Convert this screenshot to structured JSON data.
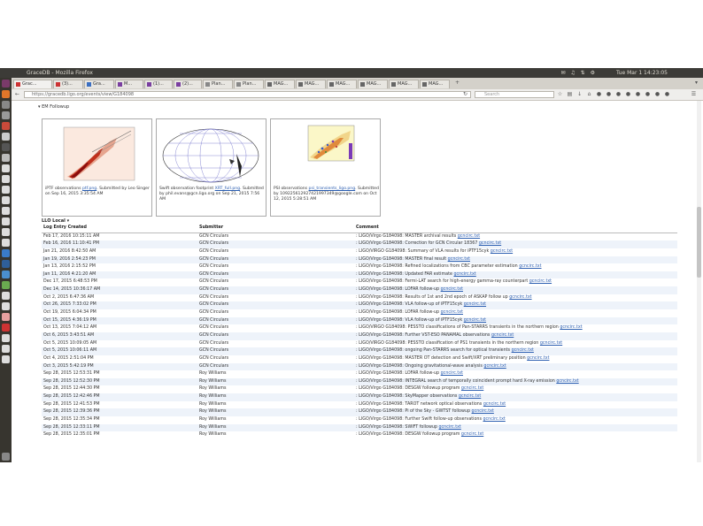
{
  "system": {
    "window_title": "GraceDB - Mozilla Firefox",
    "clock": "Tue Mar 1 14:23:05"
  },
  "browser": {
    "tabs": [
      {
        "label": "Grac..."
      },
      {
        "label": "(3)..."
      },
      {
        "label": "Gra..."
      },
      {
        "label": "M..."
      },
      {
        "label": "(1)..."
      },
      {
        "label": "(2)..."
      },
      {
        "label": "Plan..."
      },
      {
        "label": "Plan..."
      },
      {
        "label": "MAG..."
      },
      {
        "label": "MAG..."
      },
      {
        "label": "MAG..."
      },
      {
        "label": "MAG..."
      },
      {
        "label": "MAG..."
      },
      {
        "label": "MAG..."
      }
    ],
    "url": "https://gracedb.ligo.org/events/view/G184098",
    "search_placeholder": "Search"
  },
  "panel": {
    "title": "EM Followup"
  },
  "thumbnails": [
    {
      "caption_before": "iPTF observations ",
      "link": "ptf.png",
      "caption_after": ". Submitted by Leo Singer on Sep 16, 2015 3:35:54 AM"
    },
    {
      "caption_before": "Swift observation footprint ",
      "link": "XRT_full.png",
      "caption_after": ". Submitted by phil.evans@gcn.ligo.org on Sep 21, 2015 7:56 AM"
    },
    {
      "caption_before": "PSI observations ",
      "link": "psi_transients_ligo.png",
      "caption_after": ". Submitted by 109225612927421997349@google.com on Oct 12, 2015 5:28:51 AM"
    }
  ],
  "log": {
    "section_label": "LLO Local",
    "headers": {
      "col1": "Log Entry Created",
      "col2": "Submitter",
      "col3": "Comment"
    },
    "rows": [
      {
        "created": "Feb 17, 2016 10:15:11 AM",
        "submitter": "GCN Circulars",
        "comment": ": LIGO/Virgo G184098: MASTER archival results ",
        "link": "gcncirc.txt"
      },
      {
        "created": "Feb 16, 2016 11:10:41 PM",
        "submitter": "GCN Circulars",
        "comment": ": LIGO/Virgo G184098: Correction for GCN Circular 18367 ",
        "link": "gcncirc.txt"
      },
      {
        "created": "Jan 21, 2016 8:42:50 AM",
        "submitter": "GCN Circulars",
        "comment": ": LIGO/VIRGO G184098: Summary of VLA results for iPTF15cyk ",
        "link": "gcncirc.txt"
      },
      {
        "created": "Jan 19, 2016 2:54:23 PM",
        "submitter": "GCN Circulars",
        "comment": ": LIGO/Virgo G184098: MASTER final result ",
        "link": "gcncirc.txt"
      },
      {
        "created": "Jan 13, 2016 2:15:52 PM",
        "submitter": "GCN Circulars",
        "comment": ": LIGO/Virgo G184098: Refined localizations from CBC parameter estimation ",
        "link": "gcncirc.txt"
      },
      {
        "created": "Jan 11, 2016 4:21:20 AM",
        "submitter": "GCN Circulars",
        "comment": ": LIGO/Virgo G184098: Updated FAR estimate ",
        "link": "gcncirc.txt"
      },
      {
        "created": "Dec 17, 2015 6:48:53 PM",
        "submitter": "GCN Circulars",
        "comment": ": LIGO/Virgo G184098: Fermi-LAT search for high-energy gamma-ray counterpart ",
        "link": "gcncirc.txt"
      },
      {
        "created": "Dec 14, 2015 10:36:17 AM",
        "submitter": "GCN Circulars",
        "comment": ": LIGO/Virgo G184098: LOFAR follow-up ",
        "link": "gcncirc.txt"
      },
      {
        "created": "Oct 2, 2015 6:47:36 AM",
        "submitter": "GCN Circulars",
        "comment": ": LIGO/Virgo G184098: Results of 1st and 2nd epoch of ASKAP follow up ",
        "link": "gcncirc.txt"
      },
      {
        "created": "Oct 26, 2015 7:33:02 PM",
        "submitter": "GCN Circulars",
        "comment": ": LIGO/Virgo G184098: VLA follow-up of iPTF15cyk ",
        "link": "gcncirc.txt"
      },
      {
        "created": "Oct 19, 2015 6:04:34 PM",
        "submitter": "GCN Circulars",
        "comment": ": LIGO/Virgo G184098: LOFAR follow-up ",
        "link": "gcncirc.txt"
      },
      {
        "created": "Oct 15, 2015 4:36:19 PM",
        "submitter": "GCN Circulars",
        "comment": ": LIGO/Virgo G184098: VLA follow-up of iPTF15cyk ",
        "link": "gcncirc.txt"
      },
      {
        "created": "Oct 13, 2015 7:04:12 AM",
        "submitter": "GCN Circulars",
        "comment": ": LIGO/VIRGO G184098: PESSTO classifications of Pan-STARRS transients in the northern region ",
        "link": "gcncirc.txt"
      },
      {
        "created": "Oct 6, 2015 3:43:51 AM",
        "submitter": "GCN Circulars",
        "comment": ": LIGO/Virgo G184098: Further VST-ESO PANAMAL observations ",
        "link": "gcncirc.txt"
      },
      {
        "created": "Oct 5, 2015 10:09:05 AM",
        "submitter": "GCN Circulars",
        "comment": ": LIGO/VIRGO G184098: PESSTO classification of PS1 transients in the northern region ",
        "link": "gcncirc.txt"
      },
      {
        "created": "Oct 5, 2015 10:06:11 AM",
        "submitter": "GCN Circulars",
        "comment": ": LIGO/Virgo G184098: ongoing Pan-STARRS search for optical transients ",
        "link": "gcncirc.txt"
      },
      {
        "created": "Oct 4, 2015 2:51:04 PM",
        "submitter": "GCN Circulars",
        "comment": ": LIGO/Virgo G184098: MASTER OT detection and Swift/XRT preliminary position ",
        "link": "gcncirc.txt"
      },
      {
        "created": "Oct 3, 2015 5:42:19 PM",
        "submitter": "GCN Circulars",
        "comment": ": LIGO/Virgo G184098: Ongoing gravitational-wave analysis ",
        "link": "gcncirc.txt"
      },
      {
        "created": "Sep 28, 2015 12:53:31 PM",
        "submitter": "Roy Williams",
        "comment": ": LIGO/Virgo G184098: LOFAR follow-up ",
        "link": "gcncirc.txt"
      },
      {
        "created": "Sep 28, 2015 12:52:30 PM",
        "submitter": "Roy Williams",
        "comment": ": LIGO/Virgo G184098: INTEGRAL search of temporally coincident prompt hard X-ray emission ",
        "link": "gcncirc.txt"
      },
      {
        "created": "Sep 28, 2015 12:44:30 PM",
        "submitter": "Roy Williams",
        "comment": ": LIGO/Virgo G184098: DESGW followup program ",
        "link": "gcncirc.txt"
      },
      {
        "created": "Sep 28, 2015 12:42:46 PM",
        "submitter": "Roy Williams",
        "comment": ": LIGO/Virgo G184098: SkyMapper observations ",
        "link": "gcncirc.txt"
      },
      {
        "created": "Sep 28, 2015 12:41:53 PM",
        "submitter": "Roy Williams",
        "comment": ": LIGO/Virgo G184098: TAROT network optical observations ",
        "link": "gcncirc.txt"
      },
      {
        "created": "Sep 28, 2015 12:39:36 PM",
        "submitter": "Roy Williams",
        "comment": ": LIGO/Virgo G184098: Pi of the Sky - GWTST followup ",
        "link": "gcncirc.txt"
      },
      {
        "created": "Sep 28, 2015 12:35:34 PM",
        "submitter": "Roy Williams",
        "comment": ": LIGO/Virgo G184098: Further Swift follow-up observations ",
        "link": "gcncirc.txt"
      },
      {
        "created": "Sep 28, 2015 12:33:11 PM",
        "submitter": "Roy Williams",
        "comment": ": LIGO/Virgo G184098: SWIFT followup ",
        "link": "gcncirc.txt"
      },
      {
        "created": "Sep 28, 2015 12:35:01 PM",
        "submitter": "Roy Williams",
        "comment": ": LIGO/Virgo G184098: DESGW followup program ",
        "link": "gcncirc.txt"
      }
    ]
  }
}
